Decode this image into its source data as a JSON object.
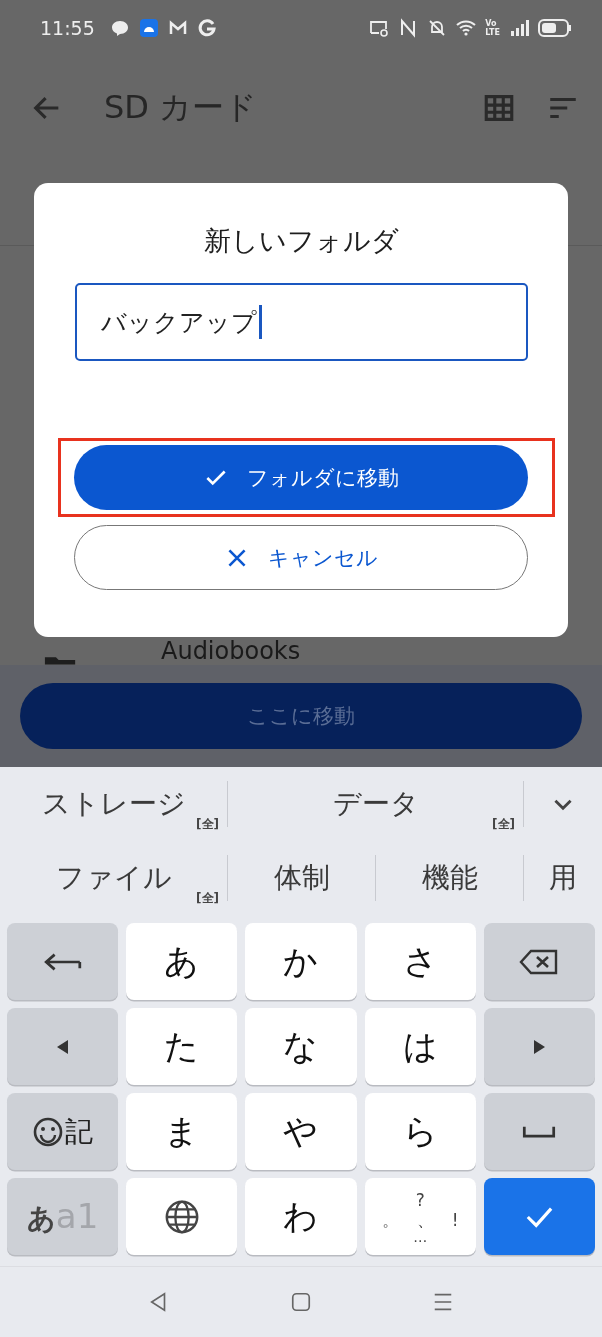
{
  "status_bar": {
    "time": "11:55",
    "network_label": [
      "Vo",
      "LTE"
    ]
  },
  "app_bar": {
    "title": "SD カード"
  },
  "list": [
    {
      "name": "Audiobooks"
    }
  ],
  "bottom_action": {
    "label": "ここに移動"
  },
  "dialog": {
    "title": "新しいフォルダ",
    "input": {
      "value": "バックアップ"
    },
    "buttons": [
      {
        "kind": "primary",
        "label": "フォルダに移動",
        "highlighted": true
      },
      {
        "kind": "outlined",
        "label": "キャンセル",
        "highlighted": false
      }
    ]
  },
  "keyboard": {
    "suggestion_rows": [
      [
        {
          "text": "ストレージ",
          "tag": "[全]"
        },
        {
          "text": "データ",
          "tag": "[全]"
        }
      ],
      [
        {
          "text": "ファイル",
          "tag": "[全]"
        },
        {
          "text": "体制"
        },
        {
          "text": "機能"
        },
        {
          "text": "用"
        }
      ]
    ],
    "keys": [
      {
        "kind": "undo"
      },
      {
        "kind": "char",
        "label": "あ"
      },
      {
        "kind": "char",
        "label": "か"
      },
      {
        "kind": "char",
        "label": "さ"
      },
      {
        "kind": "backspace"
      },
      {
        "kind": "left"
      },
      {
        "kind": "char",
        "label": "た"
      },
      {
        "kind": "char",
        "label": "な"
      },
      {
        "kind": "char",
        "label": "は"
      },
      {
        "kind": "right"
      },
      {
        "kind": "emoji",
        "label": "記"
      },
      {
        "kind": "char",
        "label": "ま"
      },
      {
        "kind": "char",
        "label": "や"
      },
      {
        "kind": "char",
        "label": "ら"
      },
      {
        "kind": "space"
      },
      {
        "kind": "mode",
        "label": "あ",
        "sub": "a1"
      },
      {
        "kind": "globe"
      },
      {
        "kind": "char",
        "label": "わ"
      },
      {
        "kind": "punct",
        "top": "?",
        "row": [
          "。",
          "、",
          "!"
        ],
        "bottom": "…"
      },
      {
        "kind": "enter"
      }
    ]
  }
}
